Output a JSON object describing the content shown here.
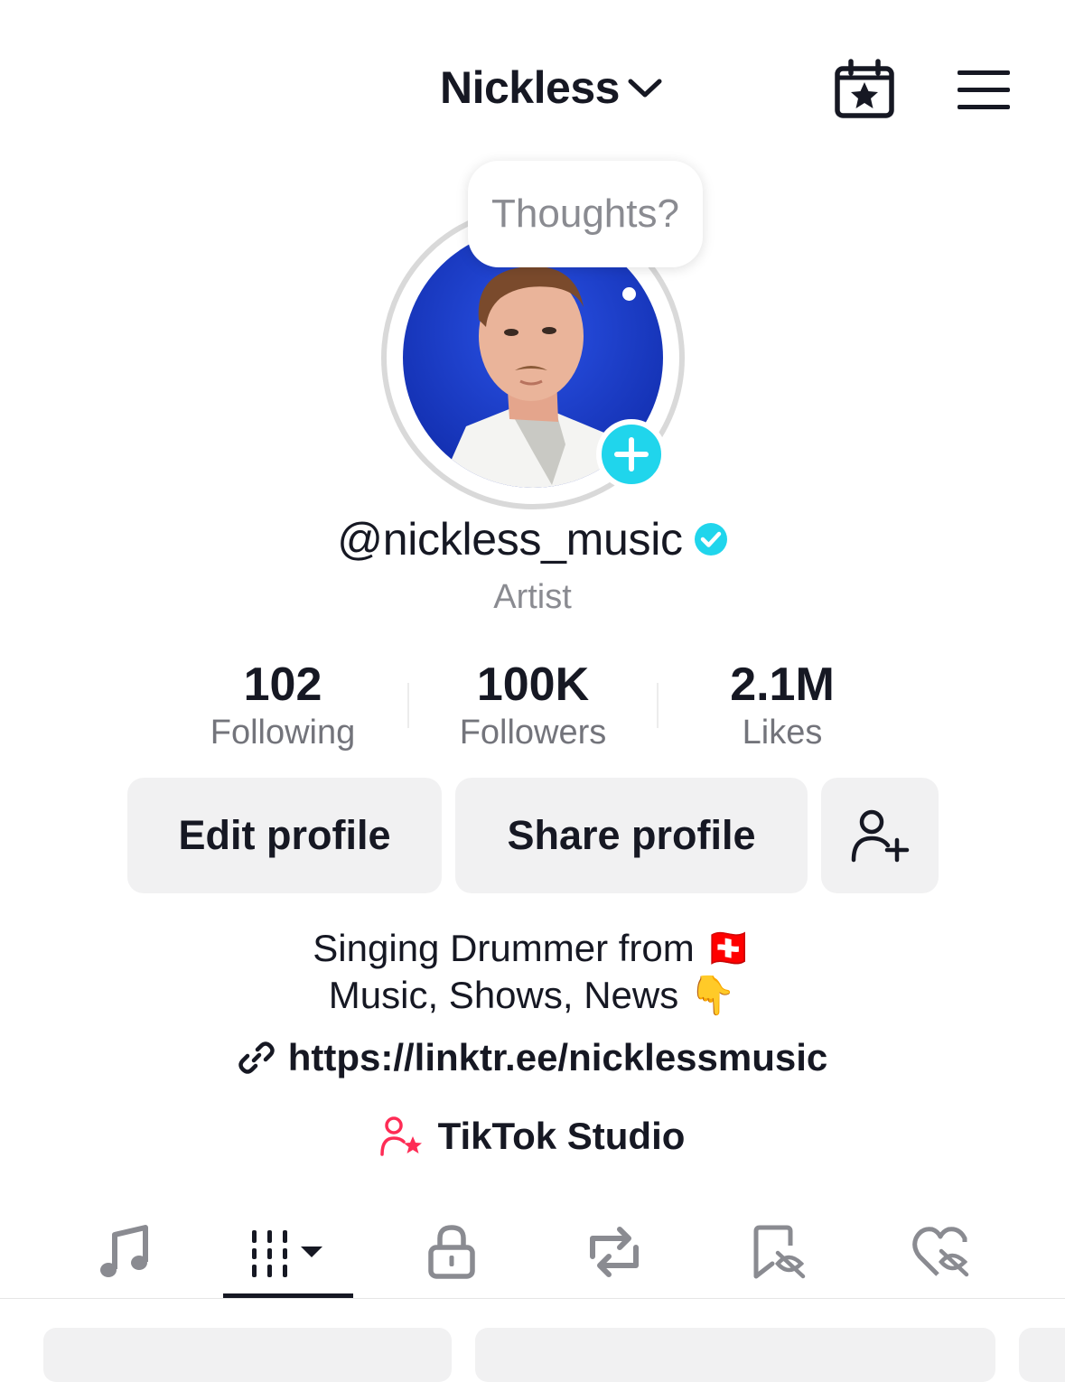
{
  "header": {
    "title": "Nickless",
    "icons": {
      "dropdown": "chevron-down-icon",
      "calendar": "calendar-star-icon",
      "menu": "hamburger-menu-icon"
    }
  },
  "profile": {
    "thought_placeholder": "Thoughts?",
    "username": "@nickless_music",
    "verified_icon": "verified-badge-icon",
    "category": "Artist"
  },
  "stats": [
    {
      "value": "102",
      "label": "Following"
    },
    {
      "value": "100K",
      "label": "Followers"
    },
    {
      "value": "2.1M",
      "label": "Likes"
    }
  ],
  "actions": {
    "edit": "Edit profile",
    "share": "Share profile",
    "add_friends_icon": "add-person-icon"
  },
  "bio": {
    "line1": "Singing Drummer from 🇨🇭",
    "line2": "Music, Shows, News 👇",
    "link": "https://linktr.ee/nicklessmusic",
    "studio": "TikTok Studio"
  },
  "tabs": [
    {
      "name": "music",
      "icon": "music-note-icon"
    },
    {
      "name": "videos",
      "icon": "grid-dropdown-icon",
      "active": true
    },
    {
      "name": "private",
      "icon": "lock-icon"
    },
    {
      "name": "reposts",
      "icon": "repost-icon"
    },
    {
      "name": "saved",
      "icon": "bookmark-hidden-icon"
    },
    {
      "name": "liked",
      "icon": "heart-hidden-icon"
    }
  ],
  "colors": {
    "accent_cyan": "#20d5ec",
    "verified": "#20d5ec",
    "studio_pink": "#fe2c55",
    "text": "#161823",
    "muted": "#8a8b91",
    "button_bg": "#f1f1f2",
    "avatar_bg": "#1a3fd0"
  }
}
